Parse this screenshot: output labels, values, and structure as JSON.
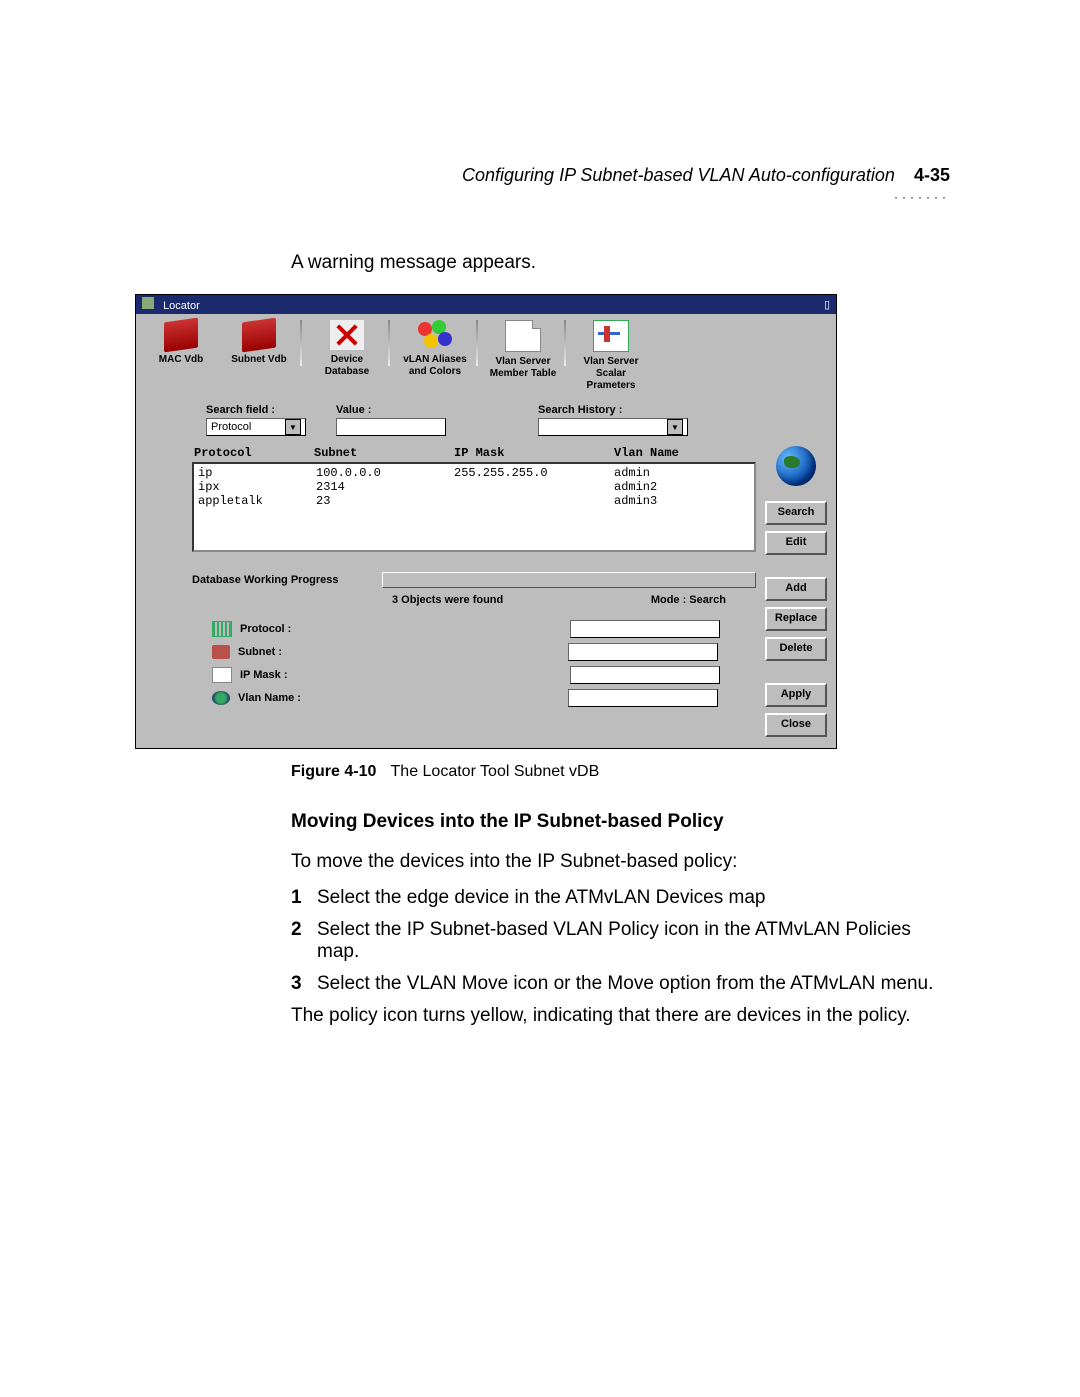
{
  "header": {
    "title": "Configuring IP Subnet-based VLAN Auto-configuration",
    "page": "4-35"
  },
  "intro": "A warning message appears.",
  "locator": {
    "title": "Locator",
    "toolbar": [
      {
        "name": "mac-vdb",
        "label": "MAC Vdb"
      },
      {
        "name": "subnet-vdb",
        "label": "Subnet Vdb"
      },
      {
        "name": "device-db",
        "label": "Device Database"
      },
      {
        "name": "vlan-aliases",
        "label": "vLAN Aliases and Colors"
      },
      {
        "name": "vlan-member",
        "label": "Vlan Server Member Table"
      },
      {
        "name": "vlan-scalar",
        "label": "Vlan Server Scalar Prameters"
      }
    ],
    "search": {
      "field_label": "Search field :",
      "field_value": "Protocol",
      "value_label": "Value :",
      "value_value": "",
      "history_label": "Search History :",
      "history_value": ""
    },
    "columns": [
      "Protocol",
      "Subnet",
      "IP Mask",
      "Vlan Name"
    ],
    "rows": [
      {
        "protocol": "ip",
        "subnet": "100.0.0.0",
        "mask": "255.255.255.0",
        "vlan": "admin"
      },
      {
        "protocol": "ipx",
        "subnet": "2314",
        "mask": "",
        "vlan": "admin2"
      },
      {
        "protocol": "appletalk",
        "subnet": "23",
        "mask": "",
        "vlan": "admin3"
      }
    ],
    "progress_label": "Database Working Progress",
    "found_text": "3 Objects were found",
    "mode_text": "Mode : Search",
    "detail_labels": {
      "protocol": "Protocol :",
      "subnet": "Subnet :",
      "mask": "IP Mask :",
      "vlan": "Vlan Name :"
    },
    "buttons": {
      "search": "Search",
      "edit": "Edit",
      "add": "Add",
      "replace": "Replace",
      "delete": "Delete",
      "apply": "Apply",
      "close": "Close"
    }
  },
  "caption": {
    "fig": "Figure 4-10",
    "text": "The Locator Tool Subnet vDB"
  },
  "section_heading": "Moving Devices into the IP Subnet-based Policy",
  "section_intro": "To move the devices into the IP Subnet-based policy:",
  "steps": [
    "Select the edge device in the ATMvLAN Devices map",
    "Select the IP Subnet-based VLAN Policy icon in the ATMvLAN Policies map.",
    "Select the VLAN Move icon or the Move option from the ATMvLAN menu."
  ],
  "conclusion": "The policy icon turns yellow, indicating that there are devices in the policy."
}
